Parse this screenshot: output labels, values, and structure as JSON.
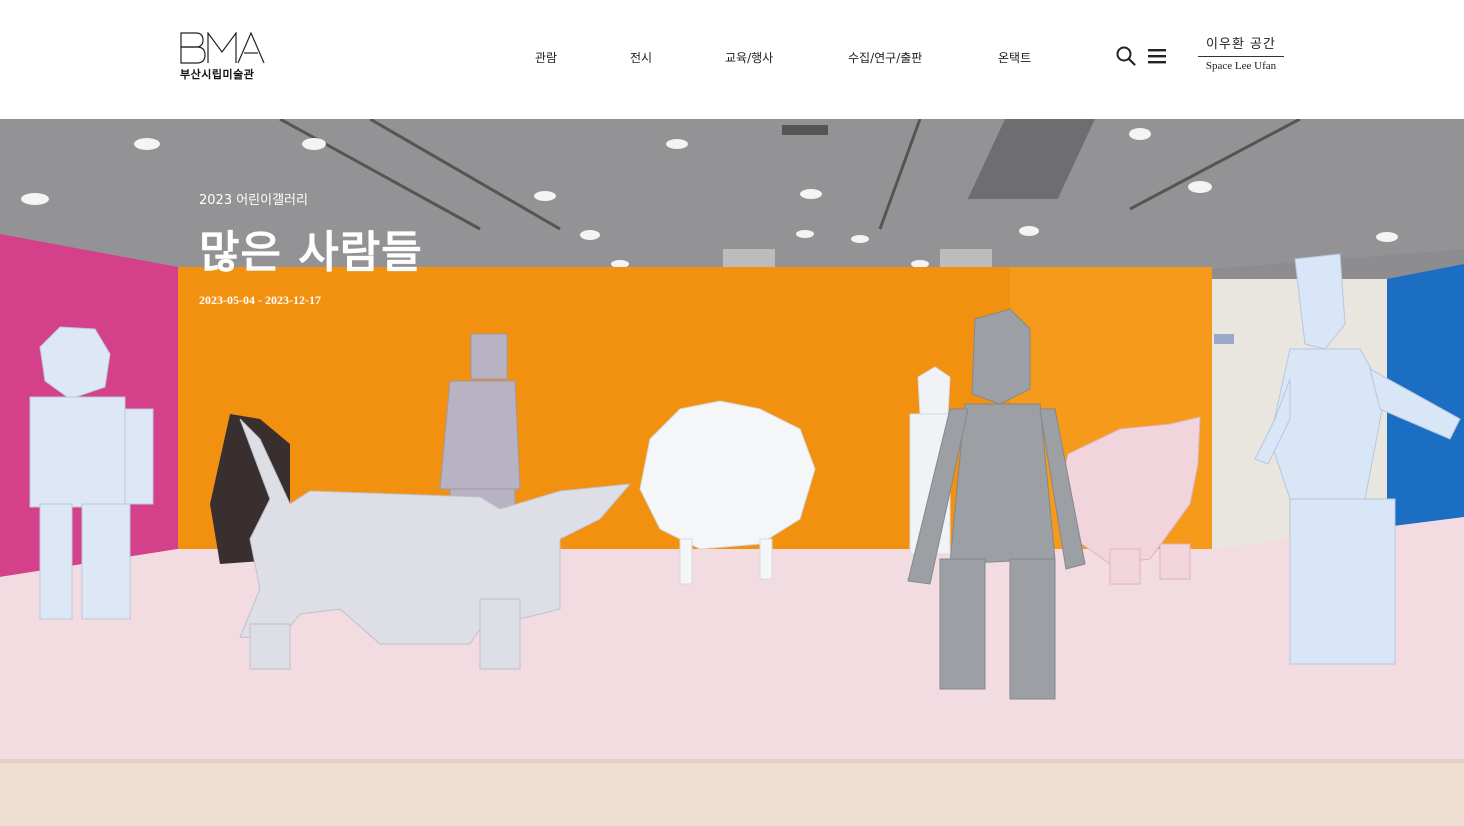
{
  "header": {
    "logo": {
      "mark_text": "BMA",
      "sub_text": "부산시립미술관"
    },
    "nav": [
      {
        "label": "관람"
      },
      {
        "label": "전시"
      },
      {
        "label": "교육/행사"
      },
      {
        "label": "수집/연구/출판"
      },
      {
        "label": "온택트"
      }
    ],
    "utility": {
      "search_icon": "search-icon",
      "menu_icon": "hamburger-menu-icon"
    },
    "space_link": {
      "ko": "이우환 공간",
      "en": "Space Lee Ufan"
    }
  },
  "hero": {
    "subtitle": "2023 어린이갤러리",
    "title": "많은 사람들",
    "date": "2023-05-04 - 2023-12-17"
  },
  "colors": {
    "header_bg": "#ffffff",
    "text_dark": "#222222",
    "wall_magenta": "#d63f86",
    "wall_orange": "#f2900f",
    "wall_blue": "#1d6fc0",
    "floor_pink": "#f3dde1",
    "ceiling_gray": "#8f8f8f"
  }
}
